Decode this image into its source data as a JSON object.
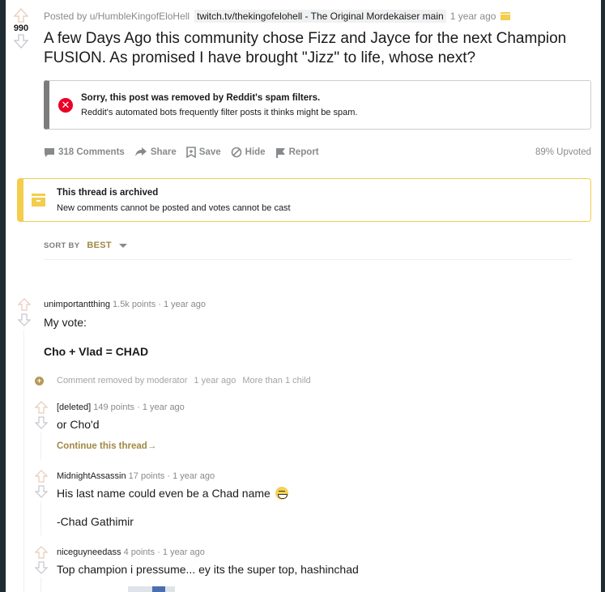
{
  "post": {
    "score": "990",
    "posted_by": "Posted by u/HumbleKingofEloHell",
    "domain": "twitch.tv/thekingofelohell - The Original Mordekaiser main",
    "time": "1 year ago",
    "title": "A few Days Ago this community chose Fizz and Jayce for the next Champion FUSION. As promised I have brought \"Jizz\" to life, whose next?",
    "removed_notice": {
      "heading": "Sorry, this post was removed by Reddit's spam filters.",
      "detail": "Reddit's automated bots frequently filter posts it thinks might be spam."
    },
    "actions": {
      "comments": "318 Comments",
      "share": "Share",
      "save": "Save",
      "hide": "Hide",
      "report": "Report",
      "upvoted": "89% Upvoted"
    }
  },
  "archived": {
    "heading": "This thread is archived",
    "detail": "New comments cannot be posted and votes cannot be cast"
  },
  "sort": {
    "label": "SORT BY",
    "value": "BEST"
  },
  "comments": [
    {
      "author": "unimportantthing",
      "points": "1.5k points",
      "time": "1 year ago",
      "line1": "My vote:",
      "line2": "Cho + Vlad = CHAD"
    },
    {
      "removed_text": "Comment removed by moderator",
      "time": "1 year ago",
      "children": "More than 1 child"
    },
    {
      "author": "[deleted]",
      "points": "149 points",
      "time": "1 year ago",
      "line1": "or Cho'd",
      "continue": "Continue this thread"
    },
    {
      "author": "MidnightAssassin",
      "points": "17 points",
      "time": "1 year ago",
      "line1": "His last name could even be a Chad name",
      "line2": "-Chad Gathimir"
    },
    {
      "author": "niceguyneedass",
      "points": "4 points",
      "time": "1 year ago",
      "line1": "Top champion i pressume... ey its the super top, hashinchad"
    }
  ],
  "colors": {
    "accent": "#a08844",
    "archive": "#f3cd4c",
    "error": "#ea0027",
    "muted": "#878a8c"
  }
}
